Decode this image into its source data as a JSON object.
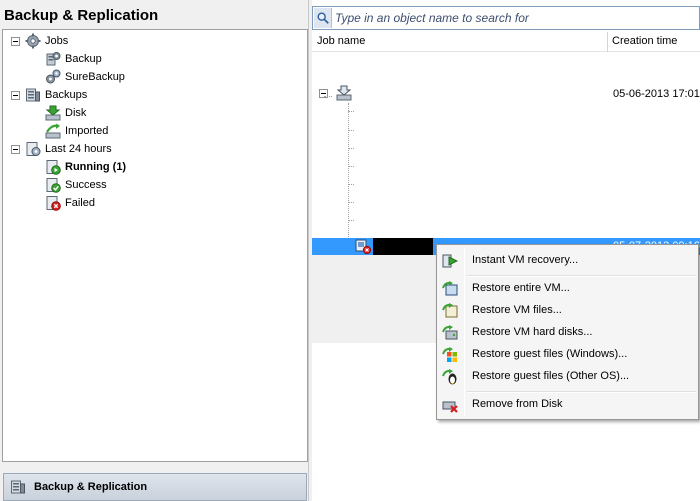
{
  "left_pane": {
    "title": "Backup & Replication",
    "tree": {
      "jobs": {
        "label": "Jobs",
        "icon": "gear-icon",
        "children": [
          {
            "label": "Backup",
            "icon": "backup-job-icon"
          },
          {
            "label": "SureBackup",
            "icon": "surebackup-icon"
          }
        ]
      },
      "backups": {
        "label": "Backups",
        "icon": "database-icon",
        "children": [
          {
            "label": "Disk",
            "icon": "disk-download-icon"
          },
          {
            "label": "Imported",
            "icon": "import-icon"
          }
        ]
      },
      "last24": {
        "label": "Last 24 hours",
        "icon": "session-icon",
        "children": [
          {
            "label": "Running (1)",
            "icon": "running-icon",
            "bold": true
          },
          {
            "label": "Success",
            "icon": "success-icon"
          },
          {
            "label": "Failed",
            "icon": "failed-icon"
          }
        ]
      }
    },
    "bottom_nav": {
      "label": "Backup & Replication",
      "icon": "server-icon"
    }
  },
  "right_pane": {
    "search": {
      "placeholder": "Type in an object name to search for",
      "icon": "search-icon"
    },
    "columns": [
      "Job name",
      "Creation time"
    ],
    "rows": [
      {
        "creation_time": "05-06-2013 17:01",
        "icon": "backup-set-icon"
      },
      {
        "creation_time": "05-07-2013 09:16",
        "icon": "vm-failed-icon",
        "selected": true
      }
    ]
  },
  "context_menu": {
    "items": [
      {
        "label": "Instant VM recovery...",
        "icon": "instant-recovery-icon"
      },
      {
        "label": "Restore entire VM...",
        "icon": "restore-vm-icon"
      },
      {
        "label": "Restore VM files...",
        "icon": "restore-files-icon"
      },
      {
        "label": "Restore VM hard disks...",
        "icon": "restore-disks-icon"
      },
      {
        "label": "Restore guest files (Windows)...",
        "icon": "windows-icon"
      },
      {
        "label": "Restore guest files (Other OS)...",
        "icon": "linux-icon"
      },
      {
        "label": "Remove from Disk",
        "icon": "remove-icon"
      }
    ]
  },
  "colors": {
    "selection": "#3399ff",
    "accent_green": "#3aa335",
    "failed_red": "#d81e1e",
    "panel_bg": "#f0f0f0"
  }
}
